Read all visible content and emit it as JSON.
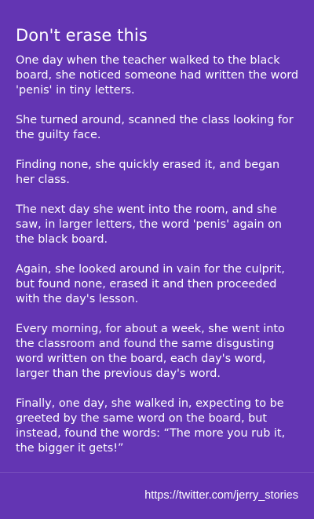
{
  "title": "Don't erase this",
  "paragraphs": [
    "One day when the teacher walked to the black board, she noticed someone had written the word 'penis' in tiny letters.",
    "She turned around, scanned the class looking for the guilty face.",
    "Finding none, she quickly erased it, and began her class.",
    "The next day she went into the room, and she saw, in larger letters, the word 'penis' again on the black board.",
    "Again, she looked around in vain for the culprit, but found none, erased it and then proceeded with the day's lesson.",
    "Every morning, for about a week, she went into the classroom and found the same disgusting word written on the board, each day's word, larger than the previous day's word.",
    "Finally, one day, she walked in, expecting to be greeted by the same word on the board, but instead, found the words: “The more you rub it, the bigger it gets!”"
  ],
  "source_link": "https://twitter.com/jerry_stories",
  "colors": {
    "background": "#6335b3",
    "text": "#ffffff"
  }
}
